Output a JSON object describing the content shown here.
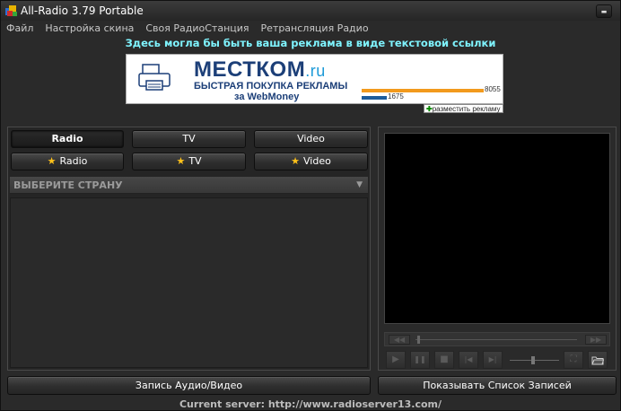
{
  "window": {
    "title": "All-Radio 3.79 Portable",
    "min_glyph": "▬"
  },
  "menu": {
    "items": [
      "Файл",
      "Настройка скина",
      "Своя РадиоСтанция",
      "Ретрансляция Радио"
    ]
  },
  "ad": {
    "text_ad": "Здесь могла бы быть ваша реклама в виде текстовой ссылки",
    "banner_brand": "МЕСТКОМ",
    "banner_brand_suffix": ".ru",
    "banner_tagline": "БЫСТРАЯ ПОКУПКА РЕКЛАМЫ",
    "banner_sub_prefix": "за ",
    "banner_sub_brand": "WebMoney",
    "bar_value_1": "8055",
    "bar_value_2": "1675",
    "place_ad_label": "разместить рекламу"
  },
  "tabs": {
    "row1": [
      "Radio",
      "TV",
      "Video"
    ],
    "row2": [
      "Radio",
      "TV",
      "Video"
    ],
    "active": "Radio"
  },
  "country": {
    "placeholder": "ВЫБЕРИТЕ СТРАНУ"
  },
  "player": {
    "rewind_glyph": "◀◀",
    "forward_glyph": "▶▶",
    "play_glyph": "▶",
    "pause_glyph": "❚❚",
    "stop_glyph": "■",
    "prev_glyph": "|◀",
    "next_glyph": "▶|",
    "screen_glyph": "⛶",
    "folder_glyph": "🗀"
  },
  "buttons": {
    "record": "Запись Аудио/Видео",
    "show_records": "Показывать Список Записей"
  },
  "status": {
    "server": "Current server: http://www.radioserver13.com/"
  },
  "colors": {
    "ad_text": "#7ff4ff",
    "star": "#ffc21a",
    "brand_blue": "#1c3f78",
    "bar_orange": "#f29a1d"
  }
}
